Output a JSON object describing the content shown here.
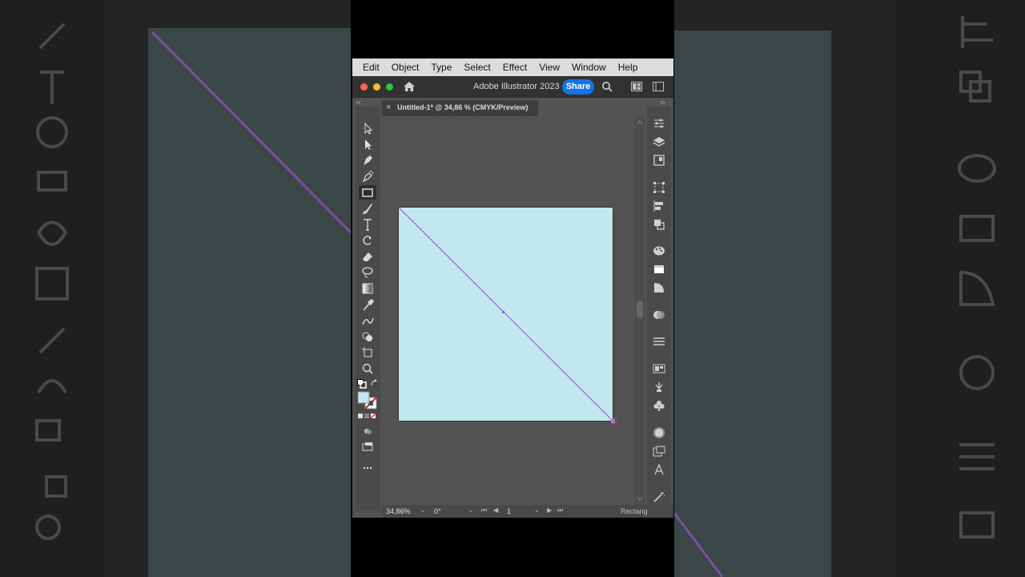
{
  "menu": [
    "Edit",
    "Object",
    "Type",
    "Select",
    "Effect",
    "View",
    "Window",
    "Help"
  ],
  "titlebar": {
    "app_title": "Adobe Illustrator 2023",
    "share_label": "Share"
  },
  "document": {
    "tab_close": "×",
    "tab_label": "Untitled-1* @ 34,86 % (CMYK/Preview)"
  },
  "statusbar": {
    "zoom": "34,86%",
    "angle": "0°",
    "page": "1",
    "tool": "Rectang"
  },
  "colors": {
    "artboard_fill": "#c2e8ef",
    "line_stroke": "#a566e0",
    "share_button": "#1473e6"
  },
  "toolbar_icons": [
    "selection-icon",
    "direct-selection-icon",
    "pen-icon",
    "curvature-icon",
    "rectangle-icon",
    "paintbrush-icon",
    "type-icon",
    "rotate-icon",
    "eraser-icon",
    "lasso-icon",
    "gradient-icon",
    "eyedropper-icon",
    "blend-icon",
    "shape-builder-icon",
    "artboard-icon",
    "zoom-icon",
    "default-colors-icon",
    "swap-colors-icon",
    "fill-stroke-swatch",
    "color-mode-icon",
    "draw-mode-icon",
    "screen-mode-icon",
    "more-tools-icon"
  ],
  "panel_icons": [
    "properties-icon",
    "layers-icon",
    "libraries-icon",
    "transform-icon",
    "align-icon",
    "pathfinder-icon",
    "color-icon",
    "swatches-icon",
    "gradient-panel-icon",
    "transparency-icon",
    "stroke-icon",
    "image-trace-icon",
    "brushes-icon",
    "symbols-icon",
    "appearance-icon",
    "graphic-styles-icon",
    "character-icon",
    "magic-wand-icon"
  ]
}
